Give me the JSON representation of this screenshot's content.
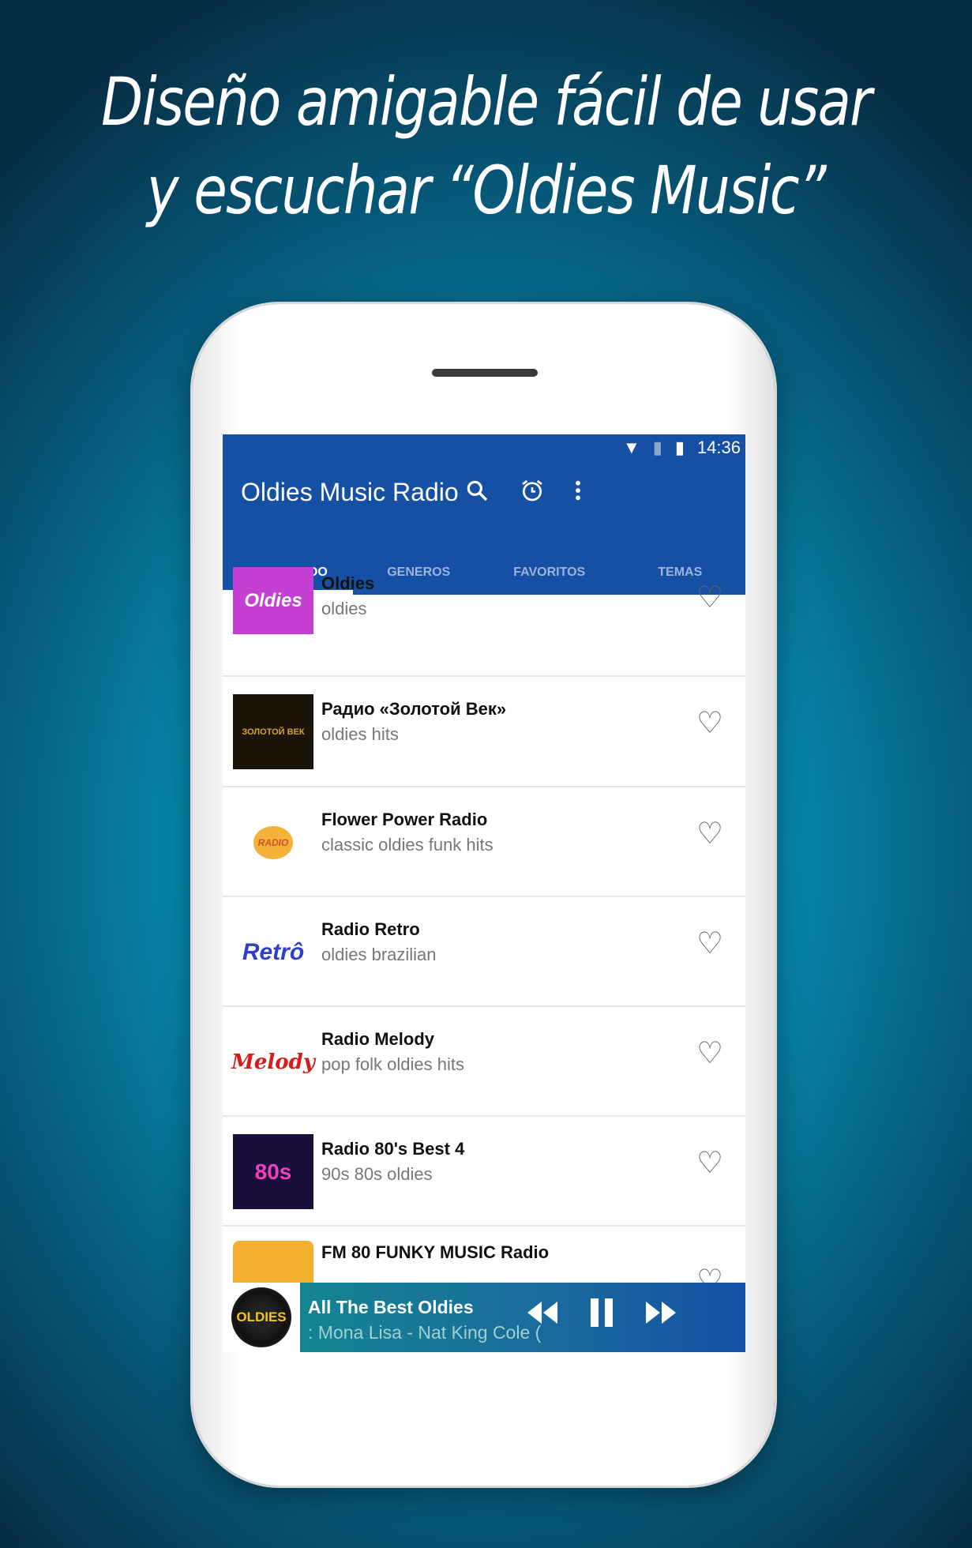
{
  "promo": {
    "line1": "Diseño amigable fácil de usar",
    "line2": "y escuchar  “Oldies Music”"
  },
  "status_bar": {
    "time": "14:36",
    "icons": [
      "wifi-icon",
      "no-sim-icon",
      "battery-icon"
    ]
  },
  "app_bar": {
    "title": "Oldies Music Radio",
    "icons": [
      "search-icon",
      "alarm-icon",
      "more-vert-icon"
    ],
    "color": "#1650a4"
  },
  "tabs": [
    {
      "label": "DESTACADO",
      "active": true
    },
    {
      "label": "GENEROS"
    },
    {
      "label": "FAVORITOS"
    },
    {
      "label": "TEMAS"
    }
  ],
  "stations": [
    {
      "name": "Oldies",
      "tags": "oldies",
      "logo": "Oldies"
    },
    {
      "name": "Радио «Золотой Век»",
      "tags": "oldies hits",
      "logo": "ЗОЛОТОЙ ВЕК"
    },
    {
      "name": "Flower Power Radio",
      "tags": "classic oldies funk hits",
      "logo": "RADIO"
    },
    {
      "name": "Radio Retro",
      "tags": "oldies brazilian",
      "logo": "Retrô"
    },
    {
      "name": "Radio Melody",
      "tags": "pop folk oldies hits",
      "logo": "Melody"
    },
    {
      "name": "Radio 80's Best 4",
      "tags": "90s 80s oldies",
      "logo": "80s"
    },
    {
      "name": "FM 80 FUNKY MUSIC Radio",
      "tags": "",
      "logo": ""
    }
  ],
  "player": {
    "station": "All The Best Oldies",
    "now_playing": ": Mona Lisa - Nat King Cole    (",
    "logo": "OLDIES",
    "controls": [
      "rewind-icon",
      "pause-icon",
      "fast-forward-icon"
    ]
  }
}
